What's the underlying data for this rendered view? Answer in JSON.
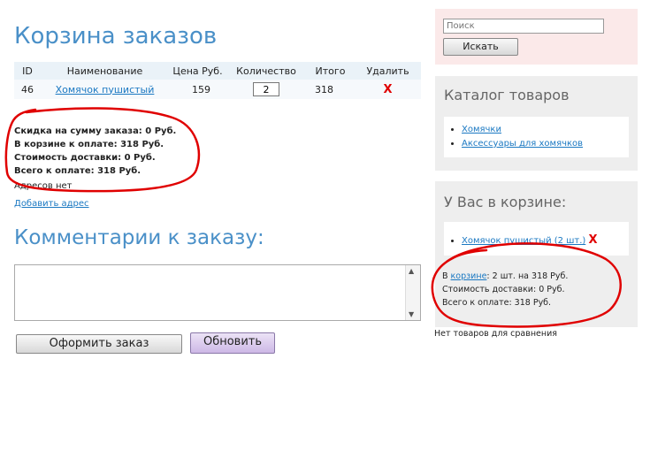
{
  "main": {
    "title": "Корзина заказов",
    "table": {
      "headers": [
        "ID",
        "Наименование",
        "Цена Руб.",
        "Количество",
        "Итого",
        "Удалить"
      ],
      "rows": [
        {
          "id": "46",
          "name": "Хомячок пушистый",
          "price": "159",
          "qty": "2",
          "total": "318",
          "delete": "X"
        }
      ]
    },
    "summary": {
      "discount": "Скидка на сумму заказа: 0 Руб.",
      "to_pay": "В корзине к оплате: 318 Руб.",
      "delivery": "Стоимость доставки: 0 Руб.",
      "grand_total": "Всего к оплате: 318 Руб."
    },
    "no_address": "Адресов нет",
    "add_address": "Добавить адрес",
    "comment_title": "Комментарии к заказу:",
    "comment_value": "",
    "order_button": "Оформить заказ",
    "update_button": "Обновить"
  },
  "sidebar": {
    "search": {
      "placeholder": "Поиск",
      "button": "Искать"
    },
    "catalog": {
      "title": "Каталог товаров",
      "items": [
        "Хомячки",
        "Аксессуары для хомячков"
      ]
    },
    "cart": {
      "title": "У Вас в корзине:",
      "item": "Хомячок пушистый (2 шт.)",
      "remove": "X",
      "info_prefix": "В ",
      "info_link": "корзине",
      "info_suffix": ": 2 шт. на 318 Руб.",
      "delivery": "Стоимость доставки: 0 Руб.",
      "total": "Всего к оплате: 318 Руб."
    },
    "compare": "Нет товаров для сравнения"
  },
  "colors": {
    "heading_blue": "#4a90c8",
    "link_blue": "#1a78c2",
    "delete_red": "#e00000",
    "annotation_red": "#e00000",
    "search_panel_bg": "#fbe9e9",
    "panel_bg": "#eeeeee"
  }
}
